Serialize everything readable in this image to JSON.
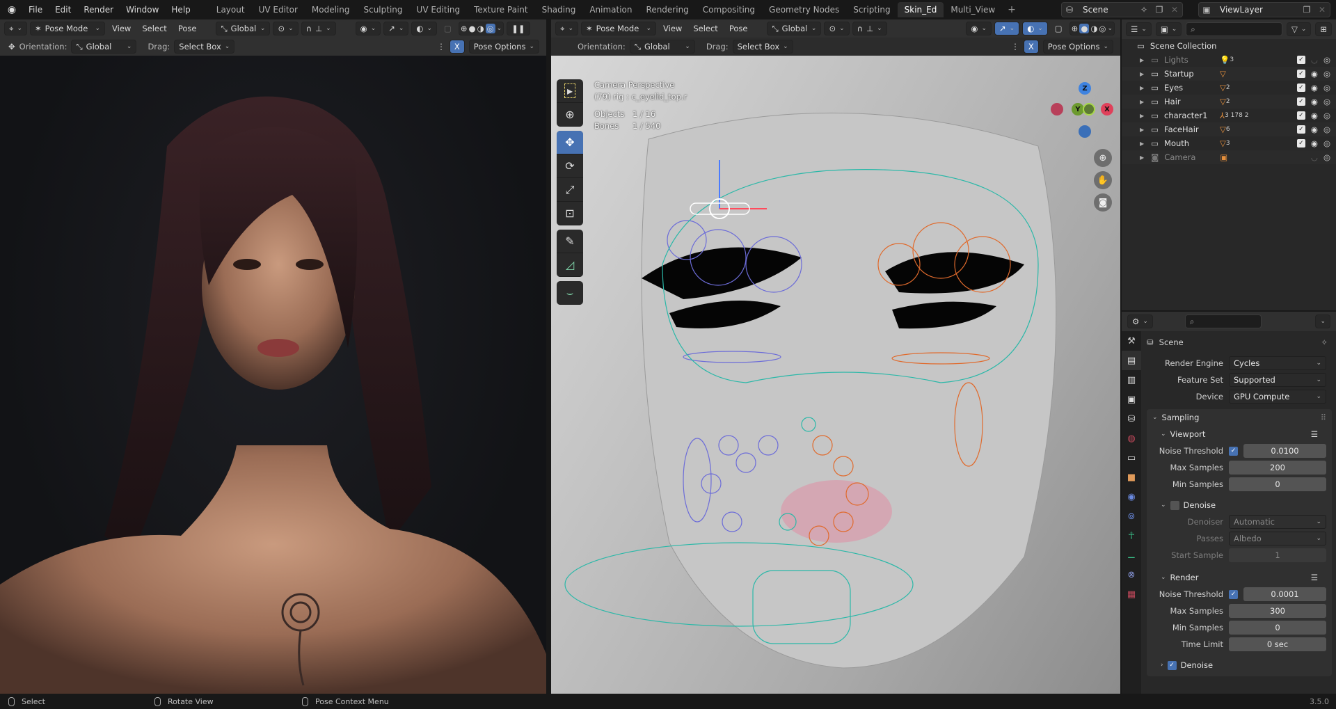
{
  "topbar": {
    "menus": [
      "File",
      "Edit",
      "Render",
      "Window",
      "Help"
    ],
    "workspaces": [
      "Layout",
      "UV Editor",
      "Modeling",
      "Sculpting",
      "UV Editing",
      "Texture Paint",
      "Shading",
      "Animation",
      "Rendering",
      "Compositing",
      "Geometry Nodes",
      "Scripting",
      "Skin_Ed",
      "Multi_View"
    ],
    "active_workspace": "Skin_Ed",
    "add_tab": "+",
    "scene": "Scene",
    "view_layer": "ViewLayer"
  },
  "left_viewport": {
    "mode": "Pose Mode",
    "menus": [
      "View",
      "Select",
      "Pose"
    ],
    "transform_orientation": "Global",
    "orientation_label": "Orientation:",
    "orientation_value": "Global",
    "drag_label": "Drag:",
    "drag_value": "Select Box",
    "x_toggle": "X",
    "pose_options": "Pose Options"
  },
  "right_viewport": {
    "mode": "Pose Mode",
    "menus": [
      "View",
      "Select",
      "Pose"
    ],
    "transform_orientation": "Global",
    "orientation_label": "Orientation:",
    "orientation_value": "Global",
    "drag_label": "Drag:",
    "drag_value": "Select Box",
    "x_toggle": "X",
    "pose_options": "Pose Options",
    "overlay": {
      "view_name": "Camera Perspective",
      "active": "(79) rig : c_eyelid_top.r",
      "objects_label": "Objects",
      "objects_value": "1 / 16",
      "bones_label": "Bones",
      "bones_value": "1 / 540"
    },
    "gizmo_axes": {
      "z": "Z",
      "y": "Y",
      "x": "X"
    },
    "tools": [
      "select-box",
      "cursor",
      "move",
      "rotate",
      "scale",
      "transform",
      "annotate",
      "measure",
      "relax"
    ],
    "active_tool": "move"
  },
  "outliner": {
    "root": "Scene Collection",
    "items": [
      {
        "name": "Lights",
        "badge": "3",
        "badge_icon": "light-icon",
        "disabled": true,
        "checked": true
      },
      {
        "name": "Startup",
        "badge": "",
        "badge_icon": "mesh-icon",
        "disabled": false,
        "checked": true
      },
      {
        "name": "Eyes",
        "badge": "2",
        "badge_icon": "mesh-icon",
        "disabled": false,
        "checked": true
      },
      {
        "name": "Hair",
        "badge": "2",
        "badge_icon": "mesh-icon",
        "disabled": false,
        "checked": true
      },
      {
        "name": "character1",
        "badge": "3 178 2",
        "badge_icon": "armature-icon",
        "disabled": false,
        "checked": true
      },
      {
        "name": "FaceHair",
        "badge": "6",
        "badge_icon": "mesh-icon",
        "disabled": false,
        "checked": true
      },
      {
        "name": "Mouth",
        "badge": "3",
        "badge_icon": "mesh-icon",
        "disabled": false,
        "checked": true
      },
      {
        "name": "Camera",
        "badge": "",
        "badge_icon": "camera-icon",
        "disabled": true,
        "checked": false
      }
    ]
  },
  "properties": {
    "context": "Scene",
    "render_engine_label": "Render Engine",
    "render_engine": "Cycles",
    "feature_set_label": "Feature Set",
    "feature_set": "Supported",
    "device_label": "Device",
    "device": "GPU Compute",
    "sampling": {
      "title": "Sampling",
      "viewport": {
        "title": "Viewport",
        "noise_threshold_label": "Noise Threshold",
        "noise_threshold_enabled": true,
        "noise_threshold": "0.0100",
        "max_samples_label": "Max Samples",
        "max_samples": "200",
        "min_samples_label": "Min Samples",
        "min_samples": "0",
        "denoise_label": "Denoise",
        "denoise_enabled": false,
        "denoiser_label": "Denoiser",
        "denoiser": "Automatic",
        "passes_label": "Passes",
        "passes": "Albedo",
        "start_sample_label": "Start Sample",
        "start_sample": "1"
      },
      "render": {
        "title": "Render",
        "noise_threshold_label": "Noise Threshold",
        "noise_threshold_enabled": true,
        "noise_threshold": "0.0001",
        "max_samples_label": "Max Samples",
        "max_samples": "300",
        "min_samples_label": "Min Samples",
        "min_samples": "0",
        "time_limit_label": "Time Limit",
        "time_limit": "0 sec",
        "denoise_label": "Denoise",
        "denoise_enabled": true
      }
    }
  },
  "statusbar": {
    "left_click": "Select",
    "middle_click": "Rotate View",
    "right_click": "Pose Context Menu",
    "version": "3.5.0"
  },
  "colors": {
    "accent": "#4772b3",
    "rig_left": "#6c6cd8",
    "rig_right": "#e06a2c",
    "rig_center": "#2ab8a8"
  }
}
